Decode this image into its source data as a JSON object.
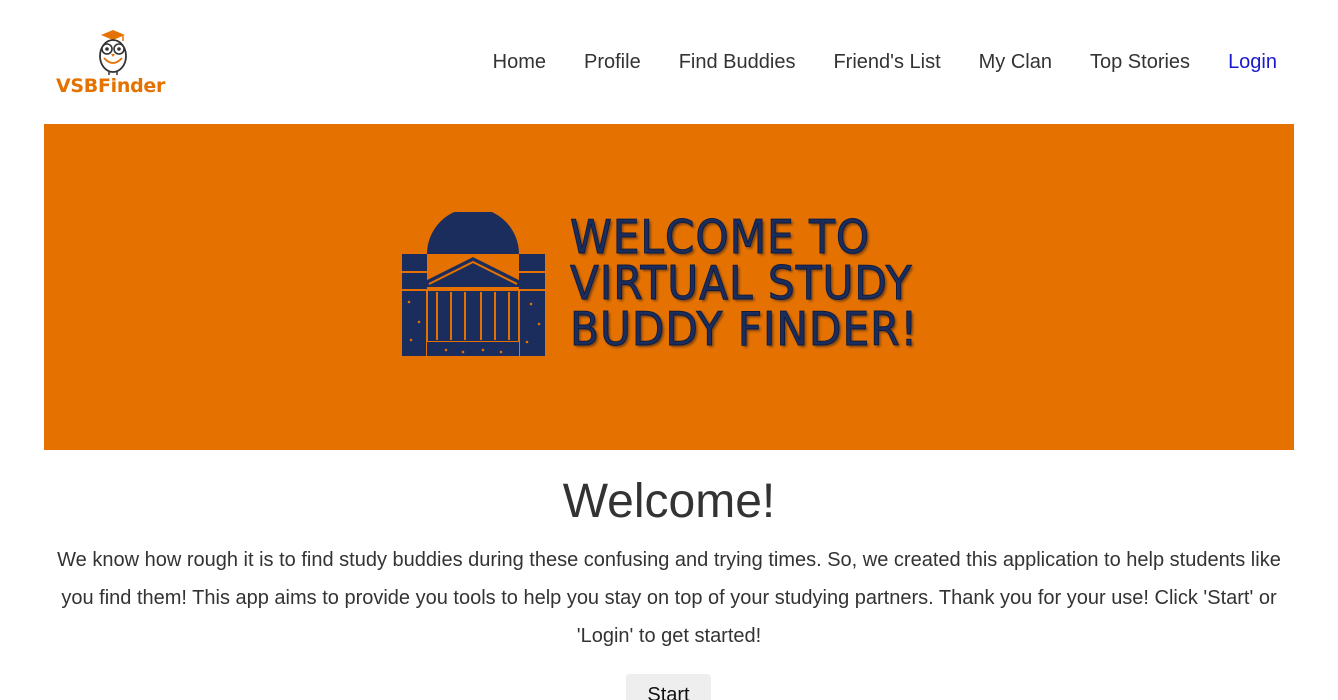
{
  "brand": {
    "name": "VSBFinder",
    "color": "#e57200"
  },
  "nav": {
    "items": [
      {
        "label": "Home"
      },
      {
        "label": "Profile"
      },
      {
        "label": "Find Buddies"
      },
      {
        "label": "Friend's List"
      },
      {
        "label": "My Clan"
      },
      {
        "label": "Top Stories"
      },
      {
        "label": "Login"
      }
    ]
  },
  "banner": {
    "line1": "Welcome to",
    "line2": "Virtual Study",
    "line3": "Buddy Finder!",
    "background": "#e57200",
    "accent": "#1b2d5c",
    "icon": "rotunda-icon"
  },
  "main": {
    "heading": "Welcome!",
    "intro": "We know how rough it is to find study buddies during these confusing and trying times. So, we created this application to help students like you find them! This app aims to provide you tools to help you stay on top of your studying partners. Thank you for your use! Click 'Start' or 'Login' to get started!",
    "start_label": "Start"
  }
}
